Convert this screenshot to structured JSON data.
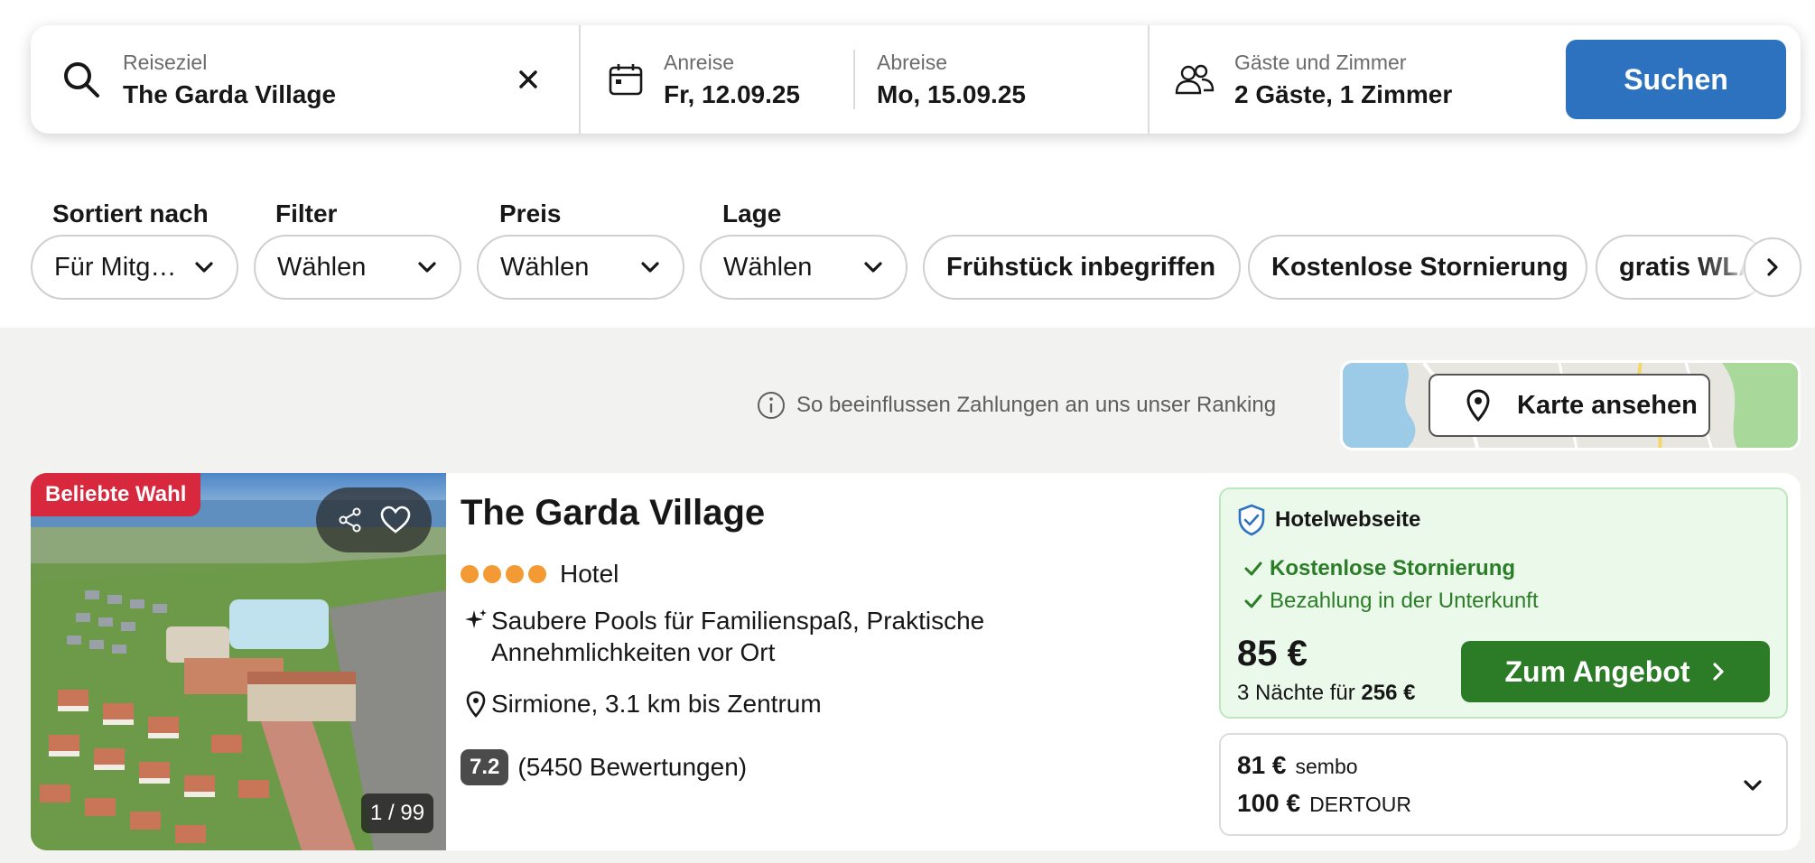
{
  "search": {
    "destination_label": "Reiseziel",
    "destination_value": "The Garda Village",
    "checkin_label": "Anreise",
    "checkin_value": "Fr, 12.09.25",
    "checkout_label": "Abreise",
    "checkout_value": "Mo, 15.09.25",
    "guests_label": "Gäste und Zimmer",
    "guests_value": "2 Gäste, 1 Zimmer",
    "search_button": "Suchen"
  },
  "filters": {
    "sort_label": "Sortiert nach",
    "sort_value": "Für Mitg…",
    "filter_label": "Filter",
    "filter_value": "Wählen",
    "price_label": "Preis",
    "price_value": "Wählen",
    "location_label": "Lage",
    "location_value": "Wählen",
    "chips": [
      "Frühstück inbegriffen",
      "Kostenlose Stornierung",
      "gratis WLAN"
    ]
  },
  "ranking_note": "So beeinflussen Zahlungen an uns unser Ranking",
  "map_button": "Karte ansehen",
  "hotel": {
    "badge": "Beliebte Wahl",
    "photo_counter": "1 / 99",
    "name": "The Garda Village",
    "type": "Hotel",
    "stars": 4,
    "features_line1": "Saubere Pools für Familienspaß, Praktische",
    "features_line2": "Annehmlichkeiten vor Ort",
    "location": "Sirmione, 3.1 km bis Zentrum",
    "score": "7.2",
    "reviews": "(5450 Bewertungen)"
  },
  "deal": {
    "provider": "Hotelwebseite",
    "perk1": "Kostenlose Stornierung",
    "perk2": "Bezahlung in der Unterkunft",
    "price": "85 €",
    "nights_prefix": "3 Nächte für",
    "nights_total": "256 €",
    "cta": "Zum Angebot"
  },
  "other_offers": [
    {
      "price": "81 €",
      "provider": "sembo"
    },
    {
      "price": "100 €",
      "provider": "DERTOUR"
    }
  ],
  "colors": {
    "primary_blue": "#2c72bf",
    "cta_green": "#2b7b27",
    "badge_red": "#d7283e",
    "star_orange": "#f39a35",
    "deal_bg": "#eaf9ea"
  }
}
